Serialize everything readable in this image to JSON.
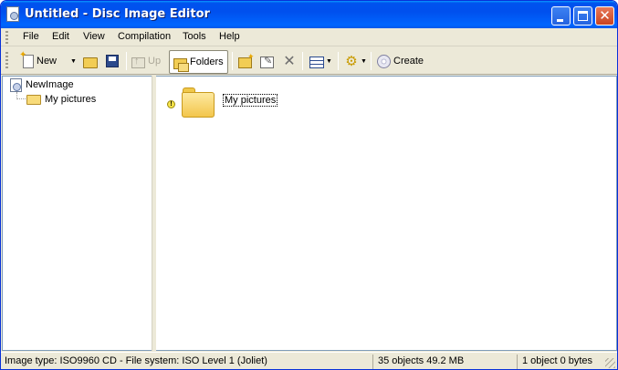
{
  "window": {
    "title": "Untitled - Disc Image Editor"
  },
  "menu": {
    "items": [
      "File",
      "Edit",
      "View",
      "Compilation",
      "Tools",
      "Help"
    ]
  },
  "toolbar": {
    "new_label": "New",
    "up_label": "Up",
    "folders_label": "Folders",
    "create_label": "Create"
  },
  "tree": {
    "root_label": "NewImage",
    "children": [
      "My pictures"
    ]
  },
  "content": {
    "items": [
      {
        "label": "My pictures",
        "icon": "folder-icon",
        "warning": true
      }
    ]
  },
  "status": {
    "image_info": "Image type: ISO9960 CD  -  File system: ISO Level 1 (Joliet)",
    "object_summary": "35 objects 49.2 MB",
    "selection_summary": "1 object 0 bytes"
  },
  "colors": {
    "titlebar": "#0053ee",
    "chrome": "#ece9d8",
    "close_button": "#c94420",
    "folder": "#f3c64c"
  }
}
